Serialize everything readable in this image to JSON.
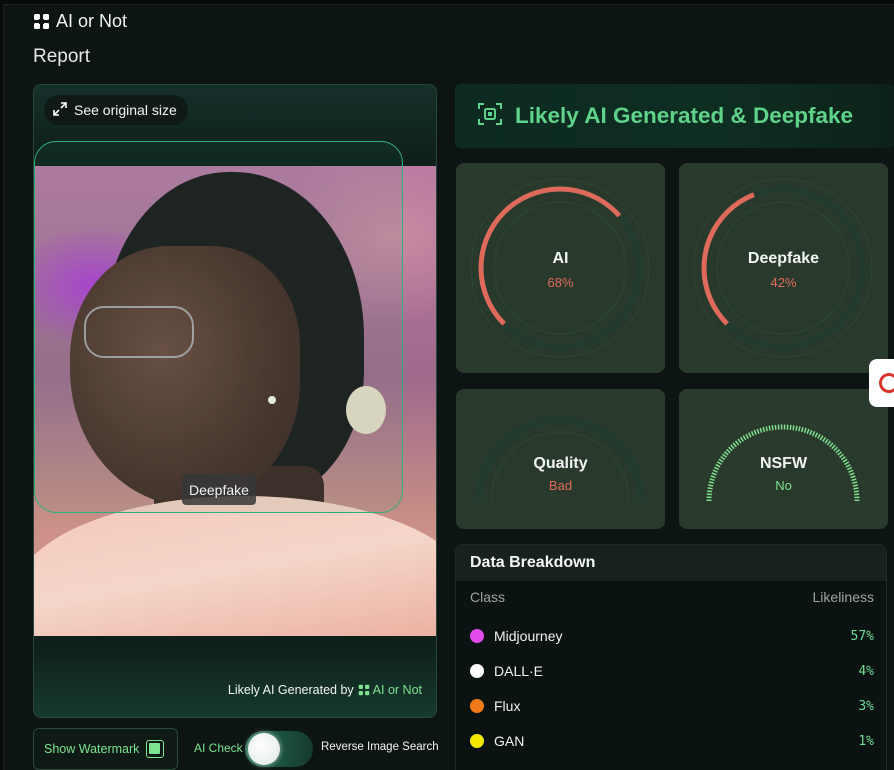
{
  "app": {
    "brand": "AI or Not",
    "page_title": "Report"
  },
  "image_panel": {
    "see_original_label": "See original size",
    "detection_label": "Deepfake",
    "credit_prefix": "Likely AI Generated by",
    "credit_brand": "AI or Not"
  },
  "controls": {
    "show_watermark_label": "Show Watermark",
    "show_watermark_checked": true,
    "ai_check_label": "AI Check",
    "reverse_search_label": "Reverse Image Search"
  },
  "verdict": {
    "text": "Likely AI Generated & Deepfake",
    "color": "#5fd38a"
  },
  "gauges": {
    "ai": {
      "label": "AI",
      "value_text": "68%",
      "value": 0.68,
      "color": "#e06a5a"
    },
    "deepfake": {
      "label": "Deepfake",
      "value_text": "42%",
      "value": 0.42,
      "color": "#e06a5a"
    },
    "quality": {
      "label": "Quality",
      "value_text": "Bad",
      "color": "#e06a5a"
    },
    "nsfw": {
      "label": "NSFW",
      "value_text": "No",
      "color": "#7fe08f"
    }
  },
  "breakdown": {
    "title": "Data Breakdown",
    "col_class": "Class",
    "col_likeliness": "Likeliness",
    "rows": [
      {
        "name": "Midjourney",
        "pct": "57%",
        "color": "#e24bea"
      },
      {
        "name": "DALL·E",
        "pct": "4%",
        "color": "#ffffff"
      },
      {
        "name": "Flux",
        "pct": "3%",
        "color": "#f07a18"
      },
      {
        "name": "GAN",
        "pct": "1%",
        "color": "#f2e800"
      }
    ]
  }
}
